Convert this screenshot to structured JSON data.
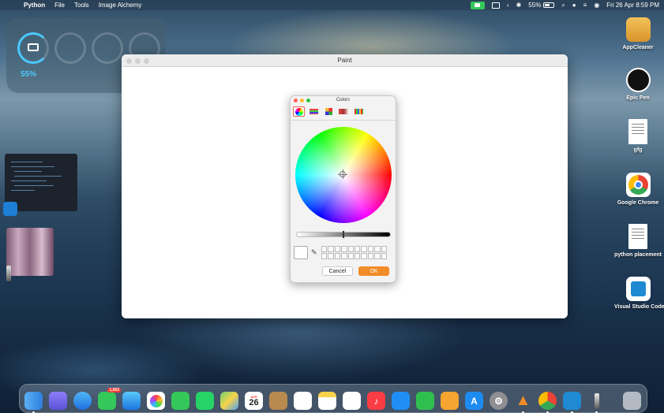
{
  "menubar": {
    "app_name": "Python",
    "menus": [
      "File",
      "Tools",
      "Image Alchemy"
    ],
    "battery_percent": "55%",
    "datetime": "Fri 26 Apr  8:59 PM"
  },
  "widget": {
    "battery_percent": "55%"
  },
  "paint_window": {
    "title": "Paint"
  },
  "colors_panel": {
    "title": "Colors",
    "cancel_label": "Cancel",
    "ok_label": "OK"
  },
  "desktop_icons": [
    {
      "label": "AppCleaner",
      "icon": "appcleaner-icon"
    },
    {
      "label": "Epic Pen",
      "icon": "epic-pen-icon"
    },
    {
      "label": "gfg",
      "icon": "document-icon"
    },
    {
      "label": "Google Chrome",
      "icon": "chrome-icon"
    },
    {
      "label": "python placement",
      "icon": "document-icon"
    },
    {
      "label": "Visual Studio Code",
      "icon": "vscode-icon"
    }
  ],
  "dock": {
    "messages_badge": "1,053",
    "calendar_month": "APR",
    "calendar_day": "26"
  },
  "colors": {
    "accent_ok": "#f28c28",
    "selected_tab_border": "#e8604c",
    "battery_ring": "#4cc9ff"
  }
}
